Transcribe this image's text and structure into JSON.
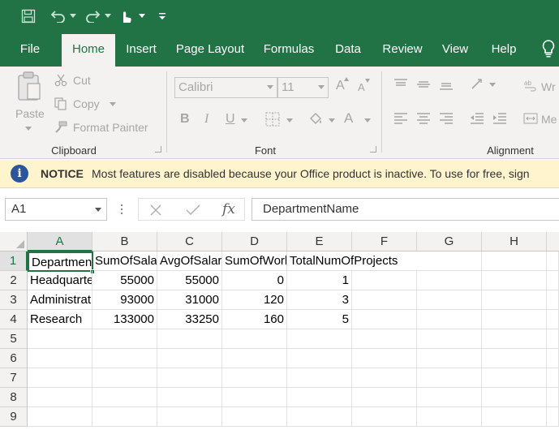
{
  "quick_access": {
    "save_icon": "save-icon",
    "undo_icon": "undo-icon",
    "redo_icon": "redo-icon",
    "touch_icon": "touch-mode-icon",
    "customize_icon": "customize-qat-icon"
  },
  "ribbon_tabs": [
    "File",
    "Home",
    "Insert",
    "Page Layout",
    "Formulas",
    "Data",
    "Review",
    "View",
    "Help"
  ],
  "active_tab": "Home",
  "clipboard": {
    "paste": "Paste",
    "cut": "Cut",
    "copy": "Copy",
    "format_painter": "Format Painter",
    "group_label": "Clipboard"
  },
  "font": {
    "name": "Calibri",
    "size": "11",
    "bold": "B",
    "italic": "I",
    "underline": "U",
    "font_color": "A",
    "grow": "A",
    "shrink": "A",
    "group_label": "Font"
  },
  "alignment": {
    "wrap_text": "Wr",
    "merge": "Me",
    "group_label": "Alignment"
  },
  "notice": {
    "title": "NOTICE",
    "message": "Most features are disabled because your Office product is inactive. To use for free, sign"
  },
  "formula_bar": {
    "name_box": "A1",
    "fx": "fx",
    "content": "DepartmentName"
  },
  "grid": {
    "columns": [
      "A",
      "B",
      "C",
      "D",
      "E",
      "F",
      "G",
      "H"
    ],
    "rows": [
      "1",
      "2",
      "3",
      "4",
      "5",
      "6",
      "7",
      "8",
      "9"
    ],
    "header_row": [
      "DepartmentName",
      "SumOfSalary",
      "AvgOfSalary",
      "SumOfWorkHours",
      "TotalNumOfProjects"
    ],
    "data_rows": [
      [
        "Headquarters",
        "55000",
        "55000",
        "0",
        "1"
      ],
      [
        "Administration",
        "93000",
        "31000",
        "120",
        "3"
      ],
      [
        "Research",
        "133000",
        "33250",
        "160",
        "5"
      ]
    ]
  },
  "colors": {
    "excel_green": "#217346",
    "ribbon_bg": "#f3f2f1",
    "notice_bg": "#fff4ce",
    "info_blue": "#2b579a"
  }
}
